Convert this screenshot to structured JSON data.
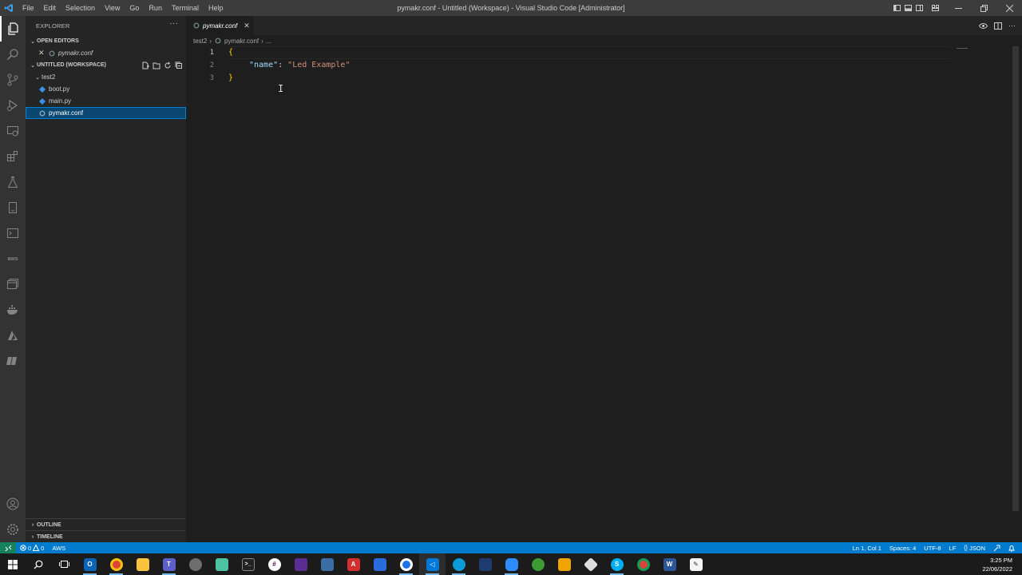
{
  "titlebar": {
    "menu": [
      "File",
      "Edit",
      "Selection",
      "View",
      "Go",
      "Run",
      "Terminal",
      "Help"
    ],
    "title": "pymakr.conf - Untitled (Workspace) - Visual Studio Code [Administrator]"
  },
  "activitybar": {
    "icons": [
      "explorer-icon",
      "search-icon",
      "source-control-icon",
      "run-debug-icon",
      "remote-explorer-icon",
      "extensions-icon",
      "testing-icon",
      "device-icon",
      "terminal-icon",
      "aws-icon",
      "pymakr-icon",
      "docker-icon",
      "azure-icon",
      "bookmarks-icon"
    ],
    "aws_label": "aws",
    "bottom_icons": [
      "account-icon",
      "settings-gear-icon"
    ]
  },
  "sidebar": {
    "title": "EXPLORER",
    "open_editors_label": "OPEN EDITORS",
    "open_editor_file": "pymakr.conf",
    "workspace_label": "UNTITLED (WORKSPACE)",
    "folder": "test2",
    "files": [
      "boot.py",
      "main.py",
      "pymakr.conf"
    ],
    "outline_label": "OUTLINE",
    "timeline_label": "TIMELINE"
  },
  "editor": {
    "tab_label": "pymakr.conf",
    "breadcrumb": {
      "folder": "test2",
      "file": "pymakr.conf",
      "more": "..."
    },
    "lines": [
      {
        "num": "1",
        "brace": "{"
      },
      {
        "num": "2",
        "key": "\"name\"",
        "colon": ": ",
        "value": "\"Led Example\""
      },
      {
        "num": "3",
        "brace": "}"
      }
    ]
  },
  "statusbar": {
    "errors": "0",
    "warnings": "0",
    "aws": "AWS",
    "position": "Ln 1, Col 1",
    "spaces": "Spaces: 4",
    "encoding": "UTF-8",
    "eol": "LF",
    "language": "JSON"
  },
  "taskbar": {
    "time": "3:25 PM",
    "date": "22/06/2022",
    "apps": [
      "outlook",
      "chrome",
      "file-explorer",
      "teams",
      "app-5",
      "notepad",
      "terminal",
      "slack",
      "visual-studio",
      "tools",
      "acrobat",
      "power-automate",
      "chrome-2",
      "vscode",
      "edge",
      "cad",
      "zoom",
      "app-18",
      "app-19",
      "virtualbox",
      "skype",
      "chrome-3",
      "word",
      "notepad-2"
    ]
  },
  "colors": {
    "accent": "#007acc",
    "selection": "#094771",
    "remote": "#16825d"
  }
}
